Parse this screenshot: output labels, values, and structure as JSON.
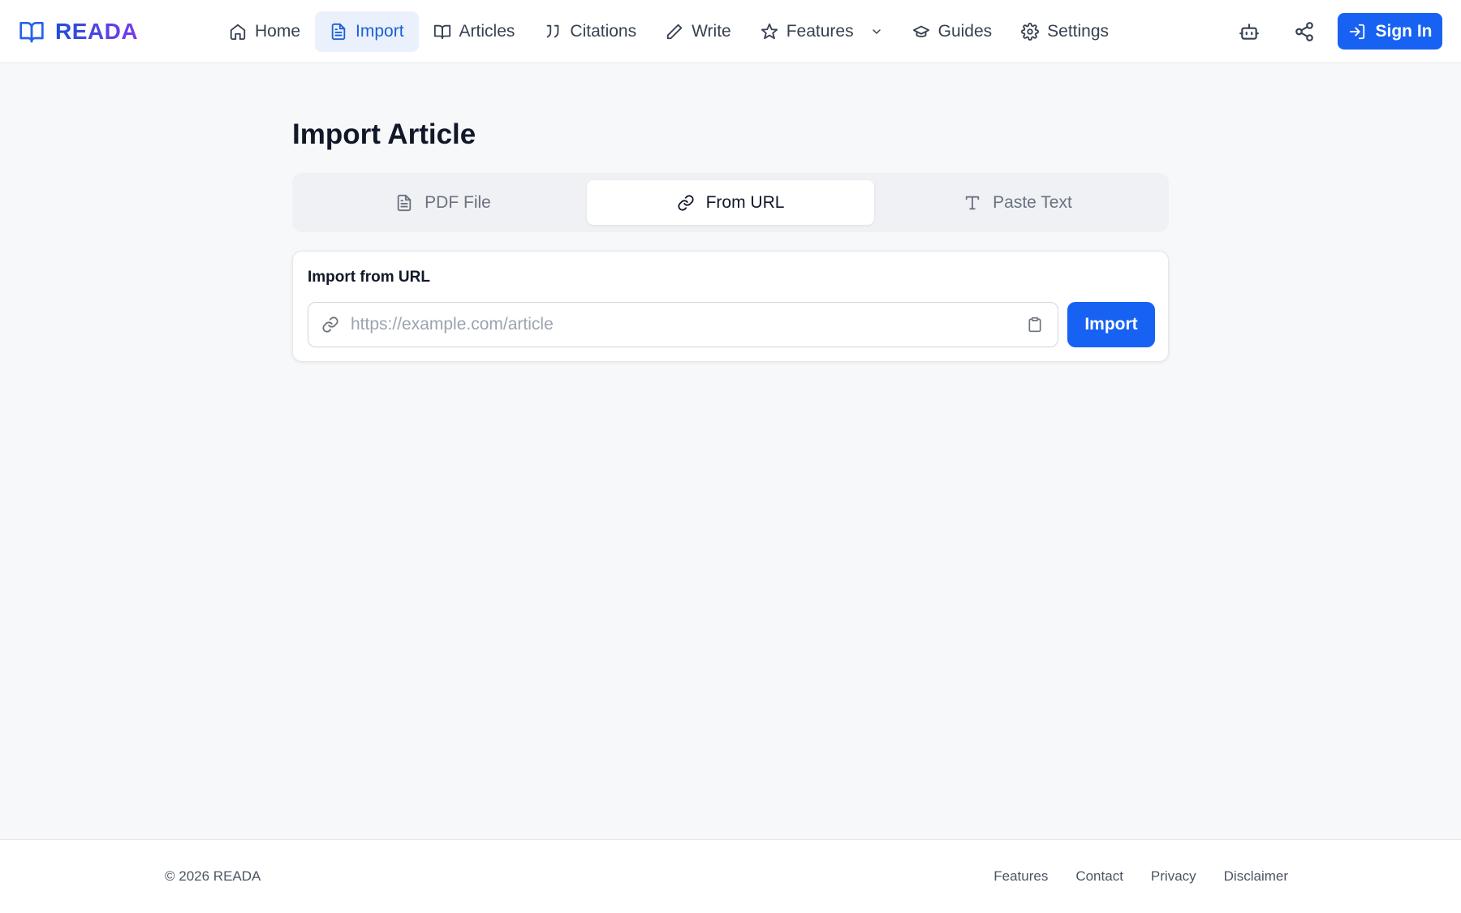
{
  "header": {
    "brand": "READA",
    "nav": [
      {
        "label": "Home",
        "icon": "home-icon"
      },
      {
        "label": "Import",
        "icon": "file-text-icon",
        "active": true
      },
      {
        "label": "Articles",
        "icon": "book-open-icon"
      },
      {
        "label": "Citations",
        "icon": "quote-icon"
      },
      {
        "label": "Write",
        "icon": "pen-icon"
      },
      {
        "label": "Features",
        "icon": "star-icon",
        "dropdown": true
      },
      {
        "label": "Guides",
        "icon": "graduation-cap-icon"
      },
      {
        "label": "Settings",
        "icon": "gear-icon"
      }
    ],
    "actions": {
      "ai_assistant_icon": "robot-icon",
      "share_icon": "share-icon"
    },
    "sign_in_label": "Sign In"
  },
  "main": {
    "title": "Import Article",
    "tabs": [
      {
        "label": "PDF File",
        "icon": "file-text-icon"
      },
      {
        "label": "From URL",
        "icon": "link-icon",
        "active": true
      },
      {
        "label": "Paste Text",
        "icon": "type-icon"
      }
    ],
    "url_panel": {
      "label": "Import from URL",
      "input_value": "",
      "input_placeholder": "https://example.com/article",
      "button_label": "Import"
    }
  },
  "footer": {
    "copyright": "© 2026 READA",
    "links": [
      "Features",
      "Contact",
      "Privacy",
      "Disclaimer"
    ]
  },
  "colors": {
    "primary": "#1762f3",
    "active_nav_bg": "#eaf1fd",
    "active_nav_text": "#1d5fd6",
    "page_bg": "#f7f8fa",
    "brand_gradient": [
      "#1d4ed8",
      "#7c3aed"
    ]
  }
}
